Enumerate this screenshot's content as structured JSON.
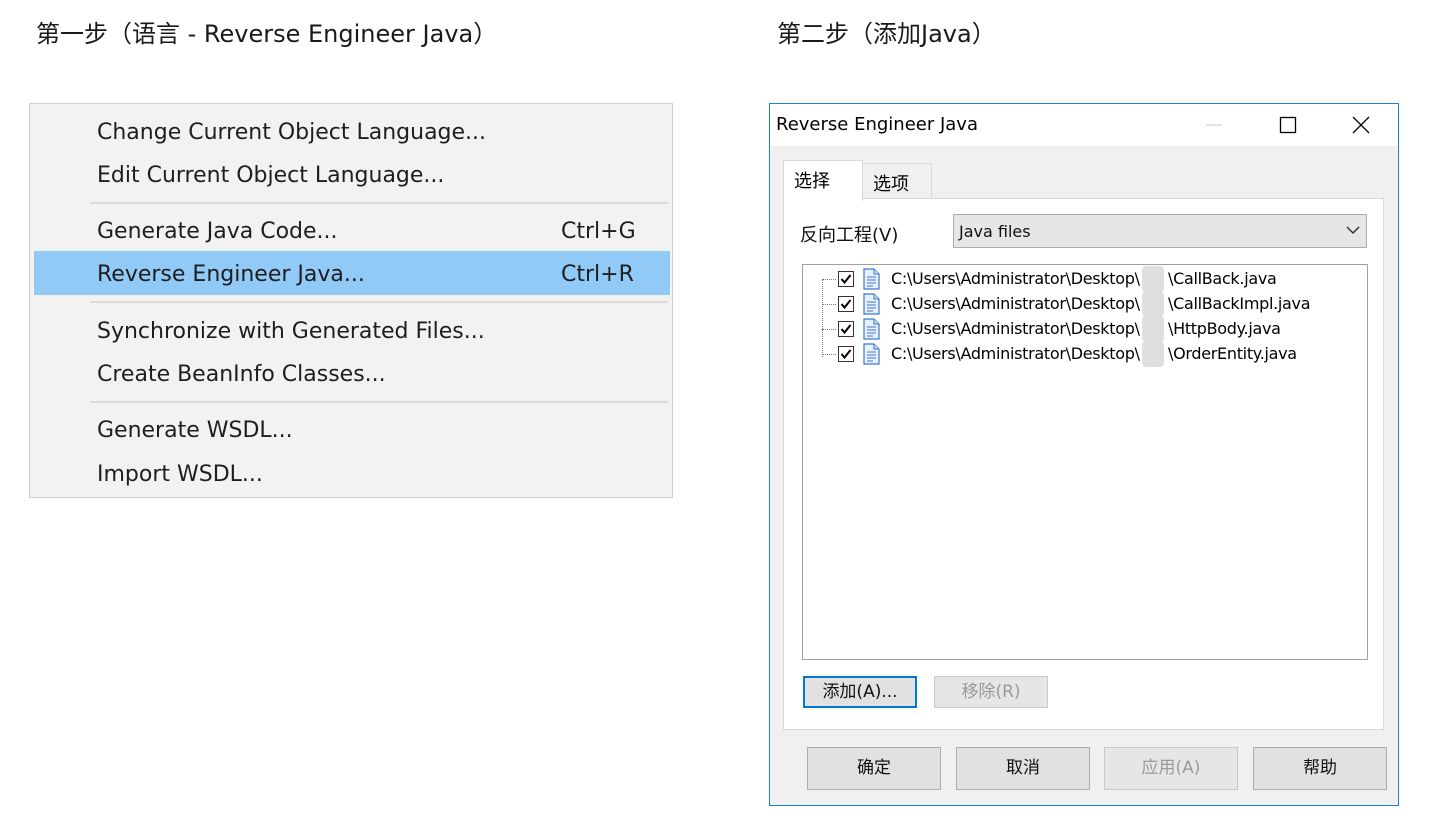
{
  "step1": {
    "title": "第一步（语言 - Reverse Engineer Java）"
  },
  "step2": {
    "title": "第二步（添加Java）"
  },
  "menu": {
    "items": [
      {
        "label": "Change Current Object Language...",
        "shortcut": ""
      },
      {
        "label": "Edit Current Object Language...",
        "shortcut": ""
      },
      {
        "label": "Generate Java Code...",
        "shortcut": "Ctrl+G"
      },
      {
        "label": "Reverse Engineer Java...",
        "shortcut": "Ctrl+R",
        "highlighted": true
      },
      {
        "label": "Synchronize with Generated Files...",
        "shortcut": ""
      },
      {
        "label": "Create BeanInfo Classes...",
        "shortcut": ""
      },
      {
        "label": "Generate WSDL...",
        "shortcut": ""
      },
      {
        "label": "Import WSDL...",
        "shortcut": ""
      }
    ],
    "highlight_color": "#91c9f7"
  },
  "dialog": {
    "title": "Reverse Engineer Java",
    "tabs": [
      {
        "label": "选择",
        "active": true
      },
      {
        "label": "选项",
        "active": false
      }
    ],
    "reverse_label": "反向工程(V)",
    "file_type": "Java files",
    "files": [
      {
        "prefix": "C:\\Users\\Administrator\\Desktop\\",
        "name": "\\CallBack.java",
        "checked": true
      },
      {
        "prefix": "C:\\Users\\Administrator\\Desktop\\",
        "name": "\\CallBackImpl.java",
        "checked": true
      },
      {
        "prefix": "C:\\Users\\Administrator\\Desktop\\",
        "name": "\\HttpBody.java",
        "checked": true
      },
      {
        "prefix": "C:\\Users\\Administrator\\Desktop\\",
        "name": "\\OrderEntity.java",
        "checked": true
      }
    ],
    "add_label": "添加(A)...",
    "remove_label": "移除(R)",
    "ok_label": "确定",
    "cancel_label": "取消",
    "apply_label": "应用(A)",
    "help_label": "帮助",
    "border_color": "#1883d7"
  }
}
